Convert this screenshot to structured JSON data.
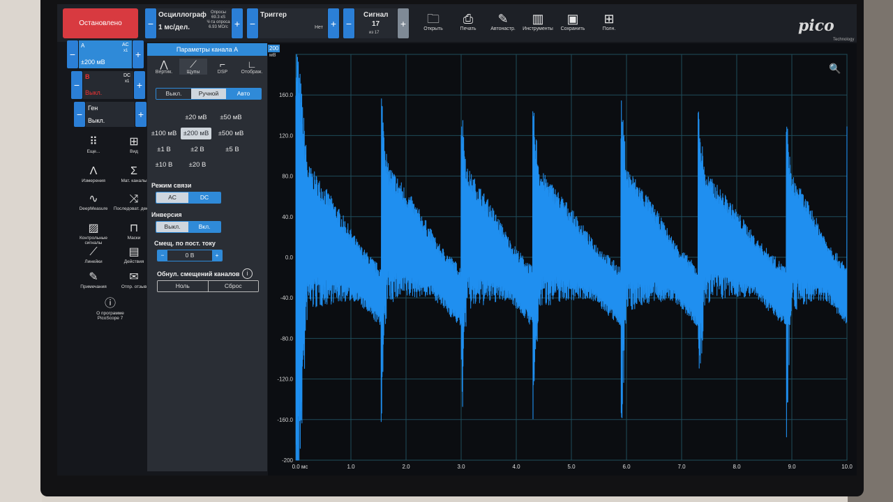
{
  "toolbar": {
    "stop_label": "Остановлено",
    "scope_title": "Осциллограф",
    "timebase": "1 мс/дел.",
    "samples_label": "Опросы",
    "samples_value": "69.3 кS",
    "rate_label": "Ч-та опроса",
    "rate_value": "6.93 МО/с",
    "trigger_title": "Триггер",
    "trigger_value": "Нет",
    "signal_title": "Сигнал",
    "signal_value": "17",
    "signal_of": "из 17",
    "plus": "+",
    "minus": "−",
    "tools": [
      {
        "label": "Открыть",
        "icon": "folder-icon"
      },
      {
        "label": "Печать",
        "icon": "printer-icon"
      },
      {
        "label": "Автонастр.",
        "icon": "wand-icon"
      },
      {
        "label": "Инструменты",
        "icon": "tools-icon"
      },
      {
        "label": "Сохранить",
        "icon": "save-icon"
      },
      {
        "label": "Полн.",
        "icon": "fullscreen-icon"
      }
    ],
    "logo": "pico",
    "logo_sub": "Technology"
  },
  "channels": {
    "a": {
      "name": "A",
      "coupling": "AC",
      "probe": "x1",
      "range": "±200 мВ"
    },
    "b": {
      "name": "B",
      "coupling": "DC",
      "probe": "x1",
      "state": "Выкл."
    },
    "gen": {
      "name": "Ген",
      "state": "Выкл."
    }
  },
  "sidebar": [
    {
      "label": "Еще...",
      "icon": "grid-dots-icon"
    },
    {
      "label": "Вид",
      "icon": "layout-grid-icon"
    },
    {
      "label": "Измерения",
      "icon": "measure-icon"
    },
    {
      "label": "Мат. каналы",
      "icon": "sigma-icon"
    },
    {
      "label": "DeepMeasure",
      "icon": "deepmeasure-icon"
    },
    {
      "label": "Последоват. декод.",
      "icon": "serial-decode-icon"
    },
    {
      "label": "Контрольные сигналы",
      "icon": "reference-icon"
    },
    {
      "label": "Маски",
      "icon": "mask-icon"
    },
    {
      "label": "Линейки",
      "icon": "ruler-icon"
    },
    {
      "label": "Действия",
      "icon": "actions-icon"
    },
    {
      "label": "Примечания",
      "icon": "note-icon"
    },
    {
      "label": "Отпр. отзыв",
      "icon": "feedback-icon"
    },
    {
      "label": "О программе PicoScope 7",
      "icon": "info-icon"
    }
  ],
  "panel": {
    "title": "Параметры канала A",
    "tabs": [
      {
        "label": "Вертик.",
        "icon": "vertical-icon"
      },
      {
        "label": "Щупы",
        "icon": "probe-icon"
      },
      {
        "label": "DSP",
        "icon": "dsp-icon"
      },
      {
        "label": "Отображ.",
        "icon": "display-icon"
      }
    ],
    "mode": [
      "Выкл.",
      "Ручной",
      "Авто"
    ],
    "mode_selected": 1,
    "ranges": [
      "±20 мВ",
      "±50 мВ",
      "±100 мВ",
      "±200 мВ",
      "±500 мВ",
      "±1 В",
      "±2 В",
      "±5 В",
      "±10 В",
      "±20 В"
    ],
    "range_selected": 3,
    "coupling_label": "Режим связи",
    "coupling": [
      "AC",
      "DC"
    ],
    "invert_label": "Инверсия",
    "invert": [
      "Выкл.",
      "Вкл."
    ],
    "offset_label": "Смещ. по пост. току",
    "offset_value": "0 В",
    "zero_label": "Обнул. смещений каналов",
    "zero_buttons": [
      "Ноль",
      "Сброс"
    ]
  },
  "chart_data": {
    "type": "line",
    "title": "",
    "scale_badge": "200",
    "ylabel": "мВ",
    "xlabel": "мс",
    "xlim": [
      0,
      10
    ],
    "ylim": [
      -200,
      200
    ],
    "yticks": [
      "160.0",
      "120.0",
      "80.0",
      "40.0",
      "0.0",
      "-40.0",
      "-80.0",
      "-120.0",
      "-160.0",
      "-200"
    ],
    "xticks": [
      "0.0 мс",
      "1.0",
      "2.0",
      "3.0",
      "4.0",
      "5.0",
      "6.0",
      "7.0",
      "8.0",
      "9.0",
      "10.0"
    ],
    "series": [
      {
        "color": "#1f8ff0",
        "period_ms": 1.45,
        "first_spike_ms": 0.1,
        "spike_peak": 175,
        "spike_trough": -185,
        "ramp_top": 45,
        "ramp_bottom": -40,
        "noise": 30,
        "spikes_x": [
          0.1,
          1.55,
          3.0,
          4.3,
          5.9,
          7.3,
          8.9,
          10.0
        ],
        "spikes_top": [
          170,
          170,
          160,
          155,
          160,
          150,
          145,
          150
        ],
        "spikes_bottom": [
          -185,
          -165,
          -185,
          -175,
          -185,
          -165,
          -185,
          -175
        ]
      }
    ]
  },
  "colors": {
    "accent": "#2f8ad8",
    "stop": "#d83a40",
    "trace": "#1f8ff0"
  }
}
